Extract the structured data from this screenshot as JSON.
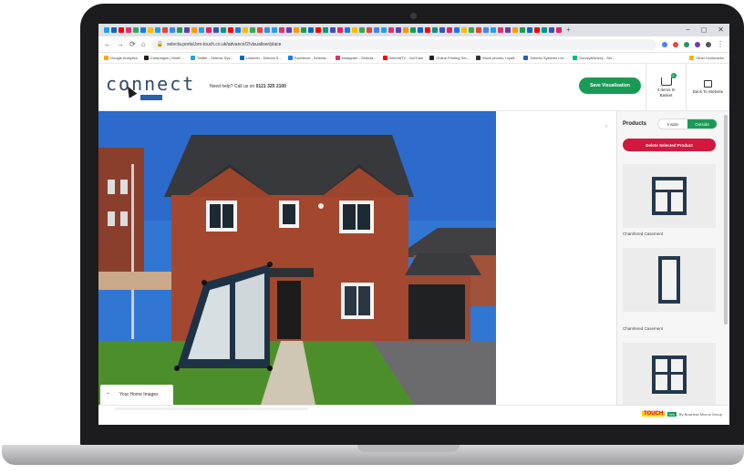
{
  "browser": {
    "url": "selecta.portal.bm-touch.co.uk/advance/2/visualiser/place",
    "bookmarks": [
      "Google Analytics",
      "Campaigns | MailC...",
      "Twitter - Selecta Sys...",
      "LinkedIn - Selecta S...",
      "Facebook - Selecta...",
      "Instagram - Selecta...",
      "SelectaTV - YouTube",
      "Online Printing Ser...",
      "Stock photos, royalt...",
      "Selecta Systems Ltd...",
      "SurveyMonkey - Sel..."
    ],
    "other_bookmarks": "Other bookmarks",
    "window_controls": [
      "–",
      "◻",
      "✕"
    ]
  },
  "header": {
    "logo_text": "connect",
    "help_prefix": "Need help? Call us on ",
    "help_phone": "0121 325 2100",
    "save_label": "Save Visualisation",
    "basket_count": "4",
    "basket_label": "4 Items In Basket",
    "back_label": "Back To Website"
  },
  "panel": {
    "title": "Products",
    "toggle": [
      "Inside",
      "Outside"
    ],
    "active_toggle": "Outside",
    "delete_label": "Delete Selected Product",
    "products": [
      {
        "name": "Chamfered Casement",
        "icon": "casement-window-icon"
      },
      {
        "name": "Chamfered Casement",
        "icon": "tall-casement-window-icon"
      },
      {
        "name": "",
        "icon": "casement-window-icon"
      }
    ]
  },
  "photo": {
    "your_home_images": "Your Home Images"
  },
  "footer": {
    "touch_logo": "TOUCH",
    "touch_badge": "bm",
    "touch_by": "By Business Micros Group"
  },
  "colors": {
    "accent_green": "#1a9a57",
    "delete_red": "#d4183d",
    "logo_blue": "#2f4a6a"
  }
}
